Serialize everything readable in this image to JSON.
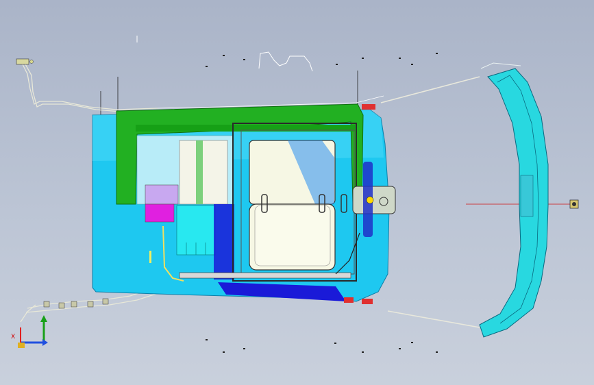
{
  "viewport": {
    "background_top": "#aab4c8",
    "background_bottom": "#c9d0dc"
  },
  "triad": {
    "x_color": "#e02020",
    "y_color": "#18a018",
    "z_color": "#2050e0",
    "x_label": "X"
  },
  "model": {
    "cab_colors": {
      "shell": "#1ec8f0",
      "roof_frame": "#22b022",
      "glass": "#f4f6e0",
      "panel_magenta": "#e020e0",
      "panel_lilac": "#c8a8f0",
      "floor_blue": "#1a1ad8",
      "door_arm": "#28d8e0",
      "red_marker": "#e03030"
    }
  }
}
